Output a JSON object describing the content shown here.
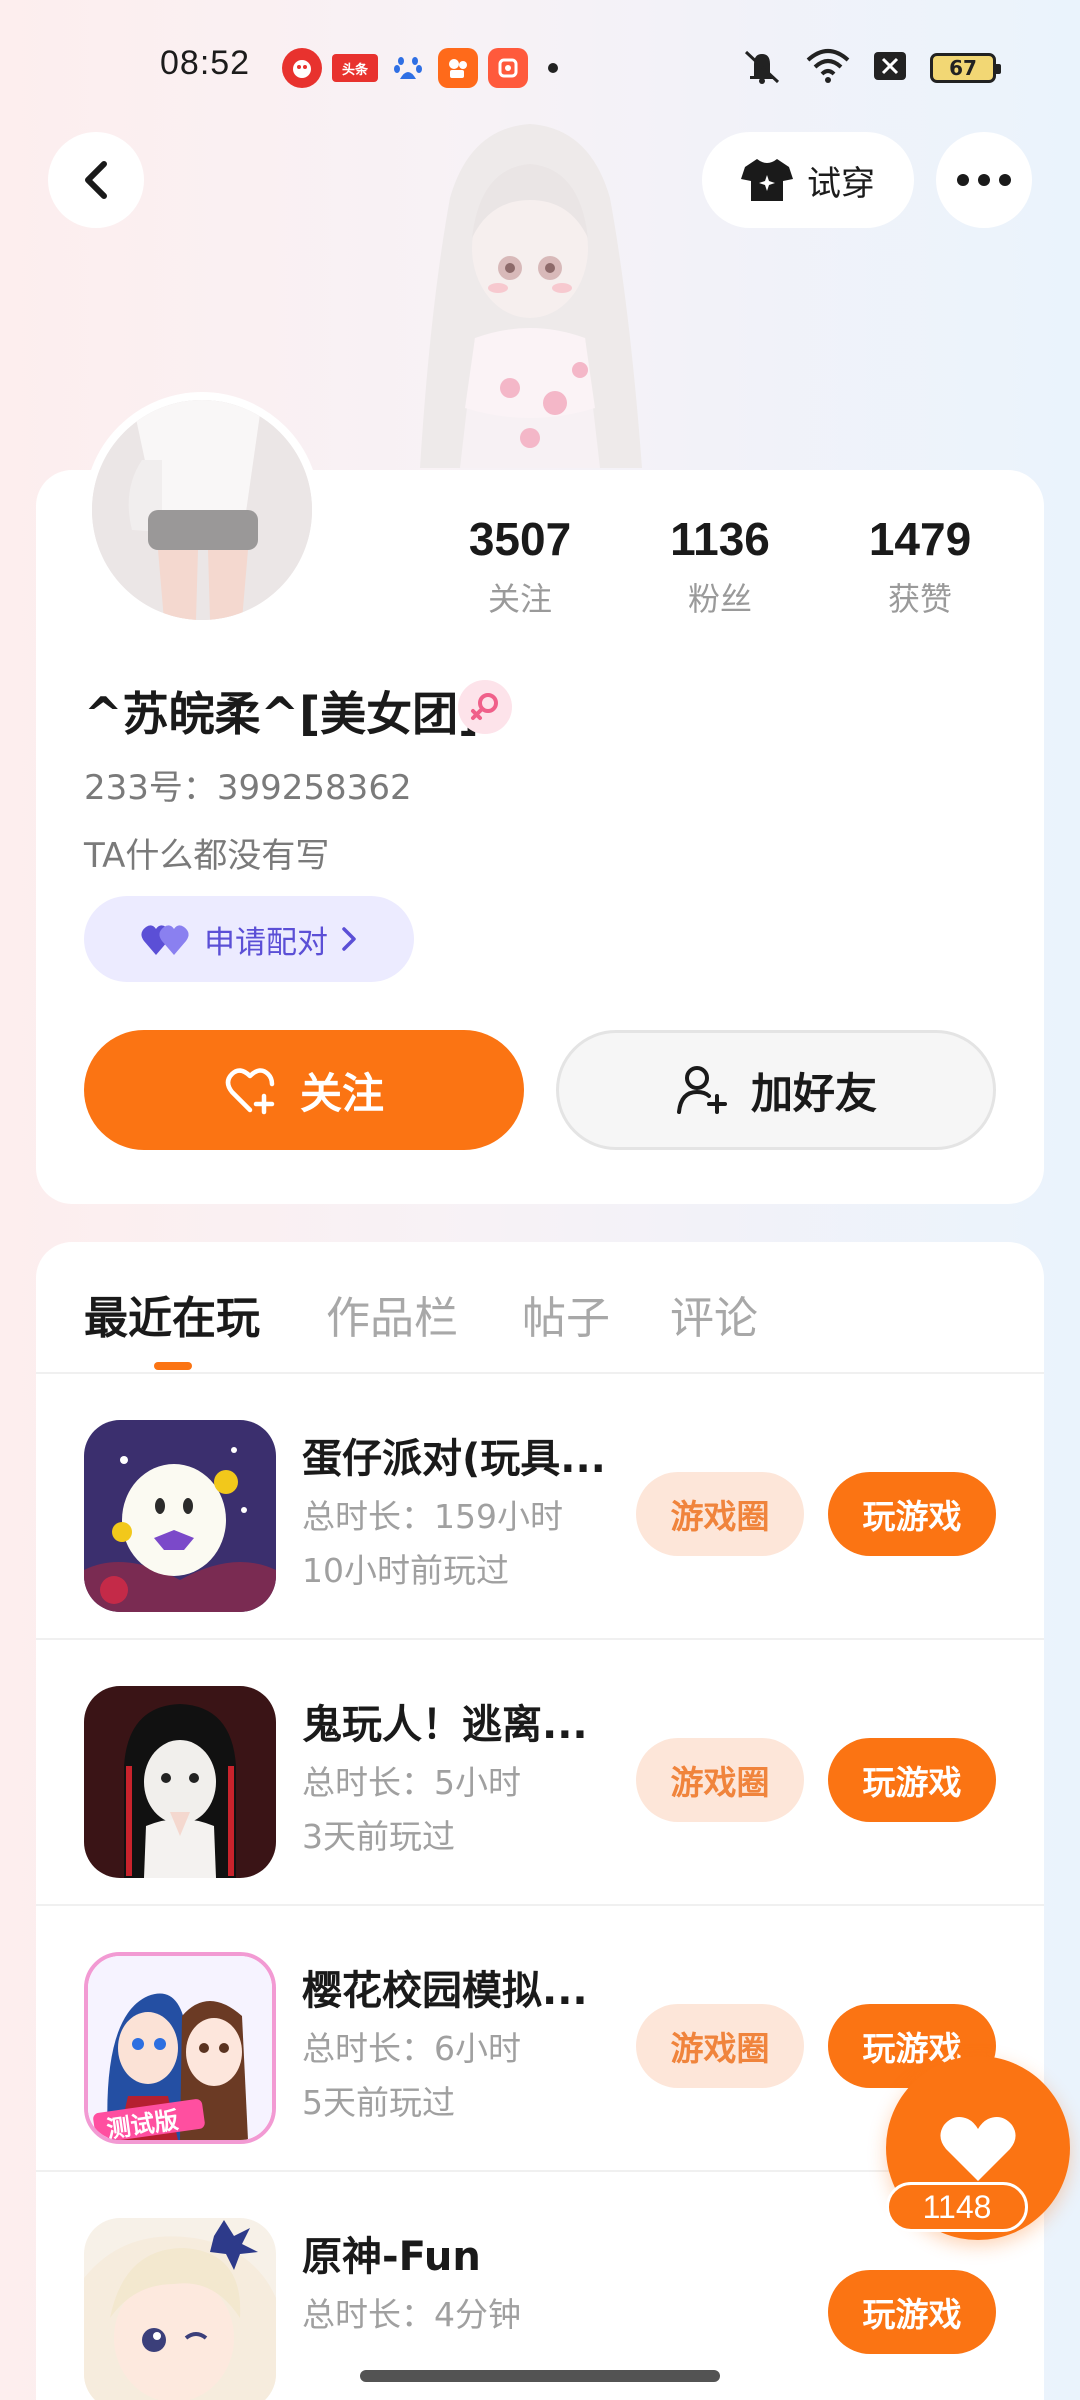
{
  "status_bar": {
    "time": "08:52",
    "notifications": [
      "pinduoduo-icon",
      "toutiao-icon",
      "baidu-icon",
      "kuaishou-icon",
      "xigua-icon"
    ],
    "toutiao_label": "头条",
    "battery": "67"
  },
  "header": {
    "try_on_label": "试穿"
  },
  "profile": {
    "stats": [
      {
        "value": "3507",
        "label": "关注"
      },
      {
        "value": "1136",
        "label": "粉丝"
      },
      {
        "value": "1479",
        "label": "获赞"
      }
    ],
    "nickname": "^苏皖柔^[美女团]",
    "account_id": "233号：399258362",
    "bio": "TA什么都没有写",
    "pair_label": "申请配对",
    "follow_label": "关注",
    "add_friend_label": "加好友"
  },
  "tabs": [
    "最近在玩",
    "作品栏",
    "帖子",
    "评论"
  ],
  "games": [
    {
      "name": "蛋仔派对(玩具...",
      "total_time": "总时长：159小时",
      "last_played": "10小时前玩过",
      "circle_label": "游戏圈",
      "play_label": "玩游戏"
    },
    {
      "name": "鬼玩人！逃离...",
      "total_time": "总时长：5小时",
      "last_played": "3天前玩过",
      "circle_label": "游戏圈",
      "play_label": "玩游戏"
    },
    {
      "name": "樱花校园模拟...",
      "total_time": "总时长：6小时",
      "last_played": "5天前玩过",
      "circle_label": "游戏圈",
      "play_label": "玩游戏",
      "icon_badge": "测试版"
    },
    {
      "name": "原神-Fun",
      "total_time": "总时长：4分钟",
      "last_played": "",
      "play_label": "玩游戏"
    }
  ],
  "like": {
    "count": "1148"
  },
  "colors": {
    "accent": "#fb7413",
    "pair": "#5b4fd6",
    "pink": "#f0608a"
  }
}
